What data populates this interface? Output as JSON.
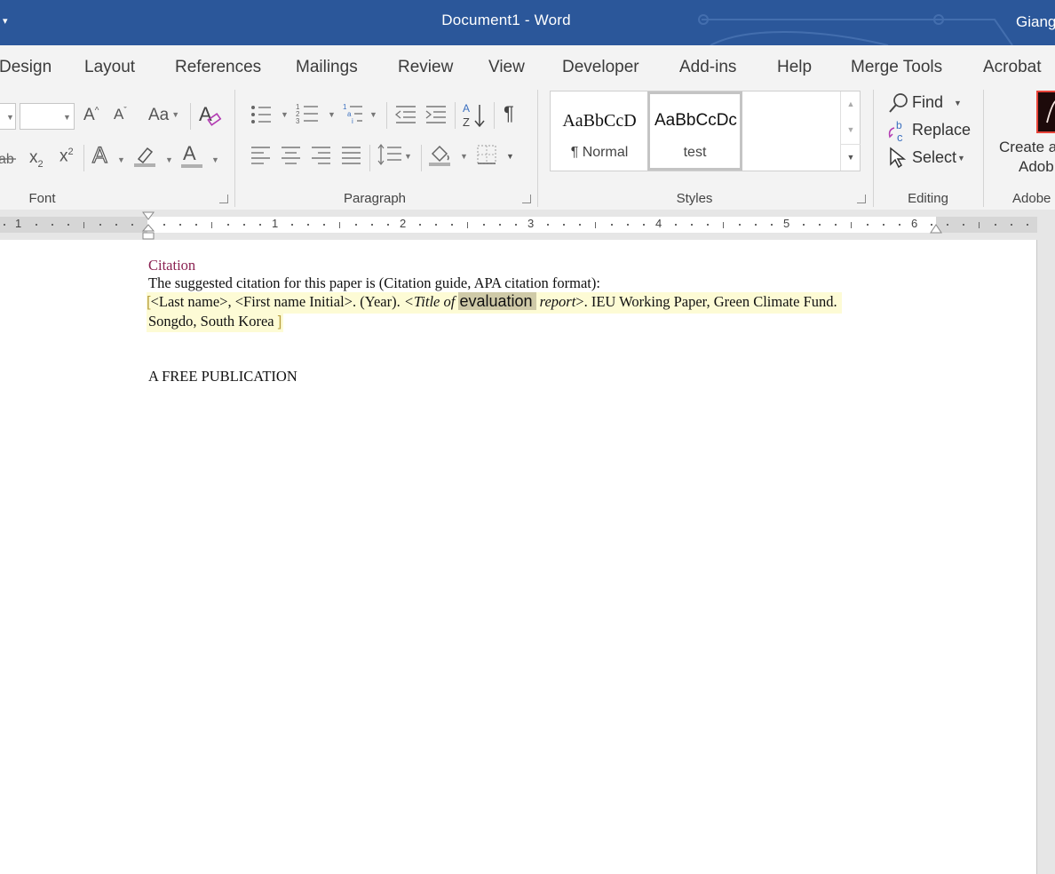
{
  "window": {
    "title": "Document1  -  Word",
    "user": "Giang",
    "accent": "#2b579a"
  },
  "tabs": [
    "Design",
    "Layout",
    "References",
    "Mailings",
    "Review",
    "View",
    "Developer",
    "Add-ins",
    "Help",
    "Merge Tools",
    "Acrobat"
  ],
  "ribbon": {
    "groups": {
      "font": "Font",
      "paragraph": "Paragraph",
      "styles": "Styles",
      "editing": "Editing",
      "adobe": "Adobe"
    },
    "font": {
      "grow": "A",
      "shrink": "A",
      "change_case": "Aa",
      "subscript": "x",
      "subscript_sub": "2",
      "superscript": "x",
      "superscript_sup": "2",
      "text_effects": "A",
      "font_color": "A"
    },
    "styles": [
      {
        "sample": "AaBbCcD",
        "name": "¶ Normal"
      },
      {
        "sample": "AaBbCcDc",
        "name": "test"
      }
    ],
    "editing": {
      "find": "Find",
      "replace": "Replace",
      "select": "Select"
    },
    "adobe": {
      "line1": "Create a",
      "line2": "Adob"
    }
  },
  "ruler": {
    "labels": [
      "1",
      "1",
      "2",
      "3",
      "4",
      "5",
      "6"
    ]
  },
  "document": {
    "heading": "Citation",
    "intro": "The suggested citation for this paper is (Citation guide, APA citation format):",
    "citation": {
      "part1": "<Last name>, <First name Initial>. (Year). ",
      "title_start": "<Title of ",
      "highlighted": "evaluation",
      "title_end": " report",
      "part2": ">. IEU Working Paper, Green Climate Fund.",
      "line2": "Songdo, South Korea"
    },
    "footer_text": "A FREE PUBLICATION"
  }
}
